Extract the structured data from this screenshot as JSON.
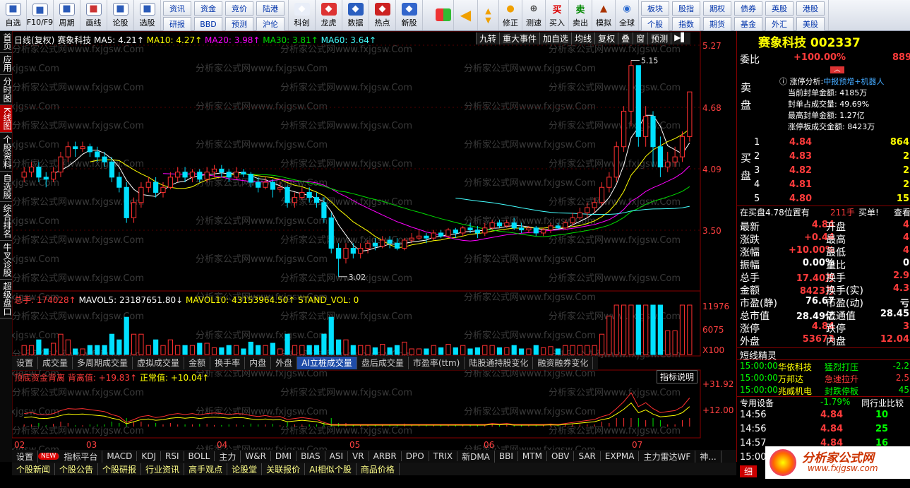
{
  "toolbar": {
    "left": [
      {
        "label": "自选",
        "icon": "star-icon"
      },
      {
        "label": "F10/F9",
        "icon": "f10-icon"
      },
      {
        "label": "周期",
        "icon": "period-icon"
      },
      {
        "label": "画线",
        "icon": "pencil-icon"
      },
      {
        "label": "论股",
        "icon": "forum-icon"
      },
      {
        "label": "选股",
        "icon": "select-icon"
      }
    ],
    "grid": [
      [
        "资讯",
        "研报"
      ],
      [
        "资金",
        "BBD"
      ],
      [
        "竞价",
        "预测"
      ],
      [
        "陆港",
        "沪伦"
      ]
    ],
    "mid": [
      {
        "label": "科创",
        "icon": "kechuang-icon"
      },
      {
        "label": "龙虎",
        "icon": "dragon-icon"
      },
      {
        "label": "数据",
        "icon": "pe-icon"
      },
      {
        "label": "热点",
        "icon": "hot-icon"
      },
      {
        "label": "新股",
        "icon": "ipo-icon"
      }
    ],
    "right": [
      {
        "label": "修正",
        "icon": "refresh-icon"
      },
      {
        "label": "测速",
        "icon": "speed-icon"
      },
      {
        "label": "买入",
        "icon": "buy-icon"
      },
      {
        "label": "卖出",
        "icon": "sell-icon"
      },
      {
        "label": "模拟",
        "icon": "hammer-icon"
      },
      {
        "label": "全球",
        "icon": "globe-icon"
      }
    ],
    "grid2": [
      [
        "板块",
        "个股"
      ],
      [
        "股指",
        "指数"
      ],
      [
        "期权",
        "期货"
      ],
      [
        "债券",
        "基金"
      ],
      [
        "英股",
        "外汇"
      ],
      [
        "港股",
        "美股"
      ]
    ],
    "letters": {
      "buy": "买",
      "sell": "卖"
    }
  },
  "sidetabs": [
    "首页",
    "应用",
    "分时图",
    "K线图",
    "个股资料",
    "自选股",
    "综合排名",
    "牛叉诊股",
    "超级盘口"
  ],
  "chart_header": {
    "prefix": "日线(复权)",
    "name": "赛象科技",
    "ma5": "MA5: 4.21↑",
    "ma10": "MA10: 4.27↑",
    "ma20": "MA20: 3.98↑",
    "ma30": "MA30: 3.81↑",
    "ma60": "MA60: 3.64↑"
  },
  "chart_tools": [
    "九转",
    "重大事件",
    "加自选",
    "均线",
    "复权",
    "叠",
    "窗",
    "预测",
    "▶▌"
  ],
  "price_axis": [
    "5.27",
    "4.68",
    "4.09",
    "3.50"
  ],
  "annotations": {
    "high": "5.15",
    "low": "3.02"
  },
  "vol_header": {
    "total": "总手: 174028↑",
    "mavol5": "MAVOL5: 23187651.80↓",
    "mavol10": "MAVOL10: 43153964.50↑",
    "stand": "STAND_VOL: 0"
  },
  "vol_axis": [
    "11976",
    "6075",
    "X100"
  ],
  "mid_tabs": [
    "设置",
    "成交量",
    "多周期成交量",
    "虚拟成交量",
    "金额",
    "换手率",
    "内盘",
    "外盘",
    "AI立桩成交量",
    "盘后成交量",
    "市盈率(ttm)",
    "陆股通持股变化",
    "融资融券变化"
  ],
  "ind_header": {
    "name": "顶底资金背离 背离值: +19.83↑",
    "normal": "正常值: +10.04↑",
    "explain": "指标说明"
  },
  "ind_axis": [
    "+31.92",
    "+12.00"
  ],
  "date_axis": [
    "02",
    "03",
    "04",
    "05",
    "06",
    "07"
  ],
  "watermark": "分析家公式网www.fxjgsw.Com",
  "bottom_tabs": [
    "设置",
    "NEW",
    "指标平台",
    "MACD",
    "KDJ",
    "RSI",
    "BOLL",
    "主力",
    "W&R",
    "DMI",
    "BIAS",
    "ASI",
    "VR",
    "ARBR",
    "DPO",
    "TRIX",
    "新DMA",
    "BBI",
    "MTM",
    "OBV",
    "SAR",
    "EXPMA",
    "主力雷达WF",
    "神..."
  ],
  "bottom_tabs2": [
    "个股新闻",
    "个股公告",
    "个股研报",
    "行业资讯",
    "高手观点",
    "论股堂",
    "关联报价",
    "AI相似个股",
    "商品价格"
  ],
  "right": {
    "title": "赛象科技 002337",
    "weibi_label": "委比",
    "weibi": "+100.00%",
    "weibi2": "889",
    "limit_title": "涨停分析:",
    "limit_tag": "中报预增+机器人",
    "limit_lines": [
      "当前封单金额: 4185万",
      "封单占成交量: 49.69%",
      "最高封单金额: 1.27亿",
      "涨停板成交金额: 8423万"
    ],
    "sell_label": "卖盘",
    "buy_label": "买盘",
    "bids": [
      {
        "n": "1",
        "p": "4.84",
        "v": "864"
      },
      {
        "n": "2",
        "p": "4.83",
        "v": "2"
      },
      {
        "n": "3",
        "p": "4.82",
        "v": "2"
      },
      {
        "n": "4",
        "p": "4.81",
        "v": "2"
      },
      {
        "n": "5",
        "p": "4.80",
        "v": "15"
      }
    ],
    "queue": "在买盘4.78位置有",
    "queue_v": "211手",
    "queue_act": "买单!",
    "queue_btn": "查看",
    "stats": [
      [
        "最新",
        "4.84",
        "开盘",
        "4"
      ],
      [
        "涨跌",
        "+0.44",
        "最高",
        "4"
      ],
      [
        "涨幅",
        "+10.00%",
        "最低",
        "4"
      ],
      [
        "振幅",
        "0.00%",
        "量比",
        "0"
      ],
      [
        "总手",
        "17.40万",
        "换手",
        "2.9"
      ],
      [
        "金额",
        "8423万",
        "换手(实)",
        "4.3"
      ],
      [
        "市盈(静)",
        "76.67",
        "市盈(动)",
        "亏"
      ],
      [
        "总市值",
        "28.49亿",
        "流通值",
        "28.45"
      ],
      [
        "涨停",
        "4.84",
        "跌停",
        "3"
      ],
      [
        "外盘",
        "53673",
        "内盘",
        "12.04"
      ]
    ],
    "elf_title": "短线精灵",
    "elf": [
      {
        "t": "15:00:00",
        "s": "华依科技",
        "e": "猛烈打压",
        "v": "-2.2"
      },
      {
        "t": "15:00:00",
        "s": "万邦达",
        "e": "急速拉升",
        "v": "2.5"
      },
      {
        "t": "15:00:00",
        "s": "兆威机电",
        "e": "封跌停板",
        "v": "45"
      }
    ],
    "device": "专用设备",
    "device_pct": "-1.79%",
    "device_more": "同行业比较",
    "ticks": [
      {
        "t": "14:56",
        "p": "4.84",
        "v": "10"
      },
      {
        "t": "14:56",
        "p": "4.84",
        "v": "25"
      },
      {
        "t": "14:57",
        "p": "4.84",
        "v": "16"
      },
      {
        "t": "15:00",
        "p": "",
        "v": ""
      }
    ],
    "logo": "分析家公式网",
    "logo_url": "www.fxjgsw.com",
    "fen": "细"
  },
  "chart_data": {
    "type": "candlestick",
    "ylim": [
      2.9,
      5.3
    ],
    "candles": [
      [
        4.0,
        4.05,
        4.1,
        3.95
      ],
      [
        4.05,
        4.1,
        4.15,
        4.0
      ],
      [
        4.1,
        4.0,
        4.15,
        3.95
      ],
      [
        4.0,
        3.98,
        4.05,
        3.9
      ],
      [
        3.98,
        4.05,
        4.1,
        3.95
      ],
      [
        4.05,
        4.2,
        4.25,
        4.0
      ],
      [
        4.2,
        4.3,
        4.35,
        4.15
      ],
      [
        4.3,
        4.28,
        4.35,
        4.2
      ],
      [
        4.28,
        4.3,
        4.35,
        4.25
      ],
      [
        4.3,
        4.25,
        4.33,
        4.2
      ],
      [
        4.25,
        4.2,
        4.3,
        4.15
      ],
      [
        4.2,
        4.15,
        4.25,
        4.1
      ],
      [
        4.15,
        4.0,
        4.2,
        3.95
      ],
      [
        4.0,
        3.9,
        4.05,
        3.85
      ],
      [
        3.9,
        3.6,
        3.95,
        3.55
      ],
      [
        3.6,
        3.75,
        3.8,
        3.55
      ],
      [
        3.75,
        3.9,
        3.95,
        3.7
      ],
      [
        3.9,
        3.95,
        4.0,
        3.85
      ],
      [
        3.95,
        3.85,
        4.0,
        3.8
      ],
      [
        3.85,
        3.9,
        3.95,
        3.8
      ],
      [
        3.9,
        4.0,
        4.05,
        3.88
      ],
      [
        4.0,
        4.05,
        4.1,
        3.95
      ],
      [
        4.05,
        4.0,
        4.1,
        3.95
      ],
      [
        4.0,
        4.05,
        4.08,
        3.95
      ],
      [
        4.05,
        3.98,
        4.08,
        3.95
      ],
      [
        3.98,
        4.05,
        4.1,
        3.95
      ],
      [
        4.05,
        4.08,
        4.12,
        4.0
      ],
      [
        4.08,
        4.05,
        4.12,
        4.0
      ],
      [
        4.05,
        4.0,
        4.08,
        3.95
      ],
      [
        4.0,
        4.05,
        4.1,
        3.98
      ],
      [
        4.05,
        4.03,
        4.08,
        4.0
      ],
      [
        4.03,
        3.95,
        4.05,
        3.9
      ],
      [
        3.95,
        3.9,
        4.0,
        3.85
      ],
      [
        3.9,
        3.95,
        4.0,
        3.88
      ],
      [
        3.95,
        3.88,
        3.98,
        3.8
      ],
      [
        3.88,
        3.9,
        3.95,
        3.85
      ],
      [
        3.9,
        3.75,
        3.92,
        3.7
      ],
      [
        3.75,
        3.8,
        3.85,
        3.7
      ],
      [
        3.8,
        3.85,
        3.9,
        3.78
      ],
      [
        3.85,
        3.8,
        3.9,
        3.75
      ],
      [
        3.8,
        3.75,
        3.85,
        3.7
      ],
      [
        3.75,
        3.6,
        3.8,
        3.55
      ],
      [
        3.6,
        3.3,
        3.65,
        3.25
      ],
      [
        3.3,
        3.2,
        3.35,
        3.02
      ],
      [
        3.2,
        3.3,
        3.35,
        3.15
      ],
      [
        3.3,
        3.25,
        3.35,
        3.2
      ],
      [
        3.25,
        3.3,
        3.35,
        3.2
      ],
      [
        3.3,
        3.35,
        3.38,
        3.25
      ],
      [
        3.35,
        3.32,
        3.4,
        3.28
      ],
      [
        3.32,
        3.38,
        3.42,
        3.3
      ],
      [
        3.38,
        3.35,
        3.42,
        3.3
      ],
      [
        3.35,
        3.3,
        3.4,
        3.28
      ],
      [
        3.3,
        3.38,
        3.4,
        3.28
      ],
      [
        3.38,
        3.4,
        3.45,
        3.35
      ],
      [
        3.4,
        3.42,
        3.48,
        3.38
      ],
      [
        3.42,
        3.4,
        3.45,
        3.35
      ],
      [
        3.4,
        3.45,
        3.48,
        3.38
      ],
      [
        3.45,
        3.42,
        3.48,
        3.4
      ],
      [
        3.42,
        3.48,
        3.5,
        3.4
      ],
      [
        3.48,
        3.45,
        3.5,
        3.4
      ],
      [
        3.45,
        3.5,
        3.52,
        3.42
      ],
      [
        3.5,
        3.48,
        3.55,
        3.45
      ],
      [
        3.48,
        3.45,
        3.52,
        3.4
      ],
      [
        3.45,
        3.5,
        3.55,
        3.42
      ],
      [
        3.5,
        3.55,
        3.58,
        3.48
      ],
      [
        3.55,
        3.52,
        3.58,
        3.5
      ],
      [
        3.52,
        3.55,
        3.58,
        3.5
      ],
      [
        3.55,
        3.5,
        3.6,
        3.48
      ],
      [
        3.5,
        3.48,
        3.55,
        3.45
      ],
      [
        3.48,
        3.5,
        3.52,
        3.45
      ],
      [
        3.5,
        3.45,
        3.52,
        3.42
      ],
      [
        3.45,
        3.48,
        3.5,
        3.42
      ],
      [
        3.48,
        3.52,
        3.55,
        3.45
      ],
      [
        3.52,
        3.5,
        3.55,
        3.48
      ],
      [
        3.5,
        3.55,
        3.58,
        3.48
      ],
      [
        3.55,
        3.6,
        3.65,
        3.52
      ],
      [
        3.6,
        3.65,
        3.7,
        3.58
      ],
      [
        3.65,
        3.7,
        3.75,
        3.6
      ],
      [
        3.7,
        3.75,
        3.8,
        3.65
      ],
      [
        3.75,
        3.9,
        3.95,
        3.72
      ],
      [
        3.9,
        4.0,
        4.05,
        3.85
      ],
      [
        4.0,
        4.3,
        4.35,
        3.95
      ],
      [
        4.3,
        4.65,
        4.7,
        4.25
      ],
      [
        4.65,
        5.1,
        5.15,
        4.5
      ],
      [
        5.1,
        4.4,
        5.0,
        4.3
      ],
      [
        4.4,
        4.6,
        4.7,
        4.3
      ],
      [
        4.6,
        4.3,
        4.65,
        4.1
      ],
      [
        4.3,
        4.1,
        4.4,
        4.0
      ],
      [
        4.1,
        4.15,
        4.25,
        4.05
      ],
      [
        4.15,
        4.2,
        4.3,
        4.1
      ],
      [
        4.2,
        4.4,
        4.45,
        4.15
      ],
      [
        4.4,
        4.84,
        4.84,
        4.35
      ]
    ]
  }
}
